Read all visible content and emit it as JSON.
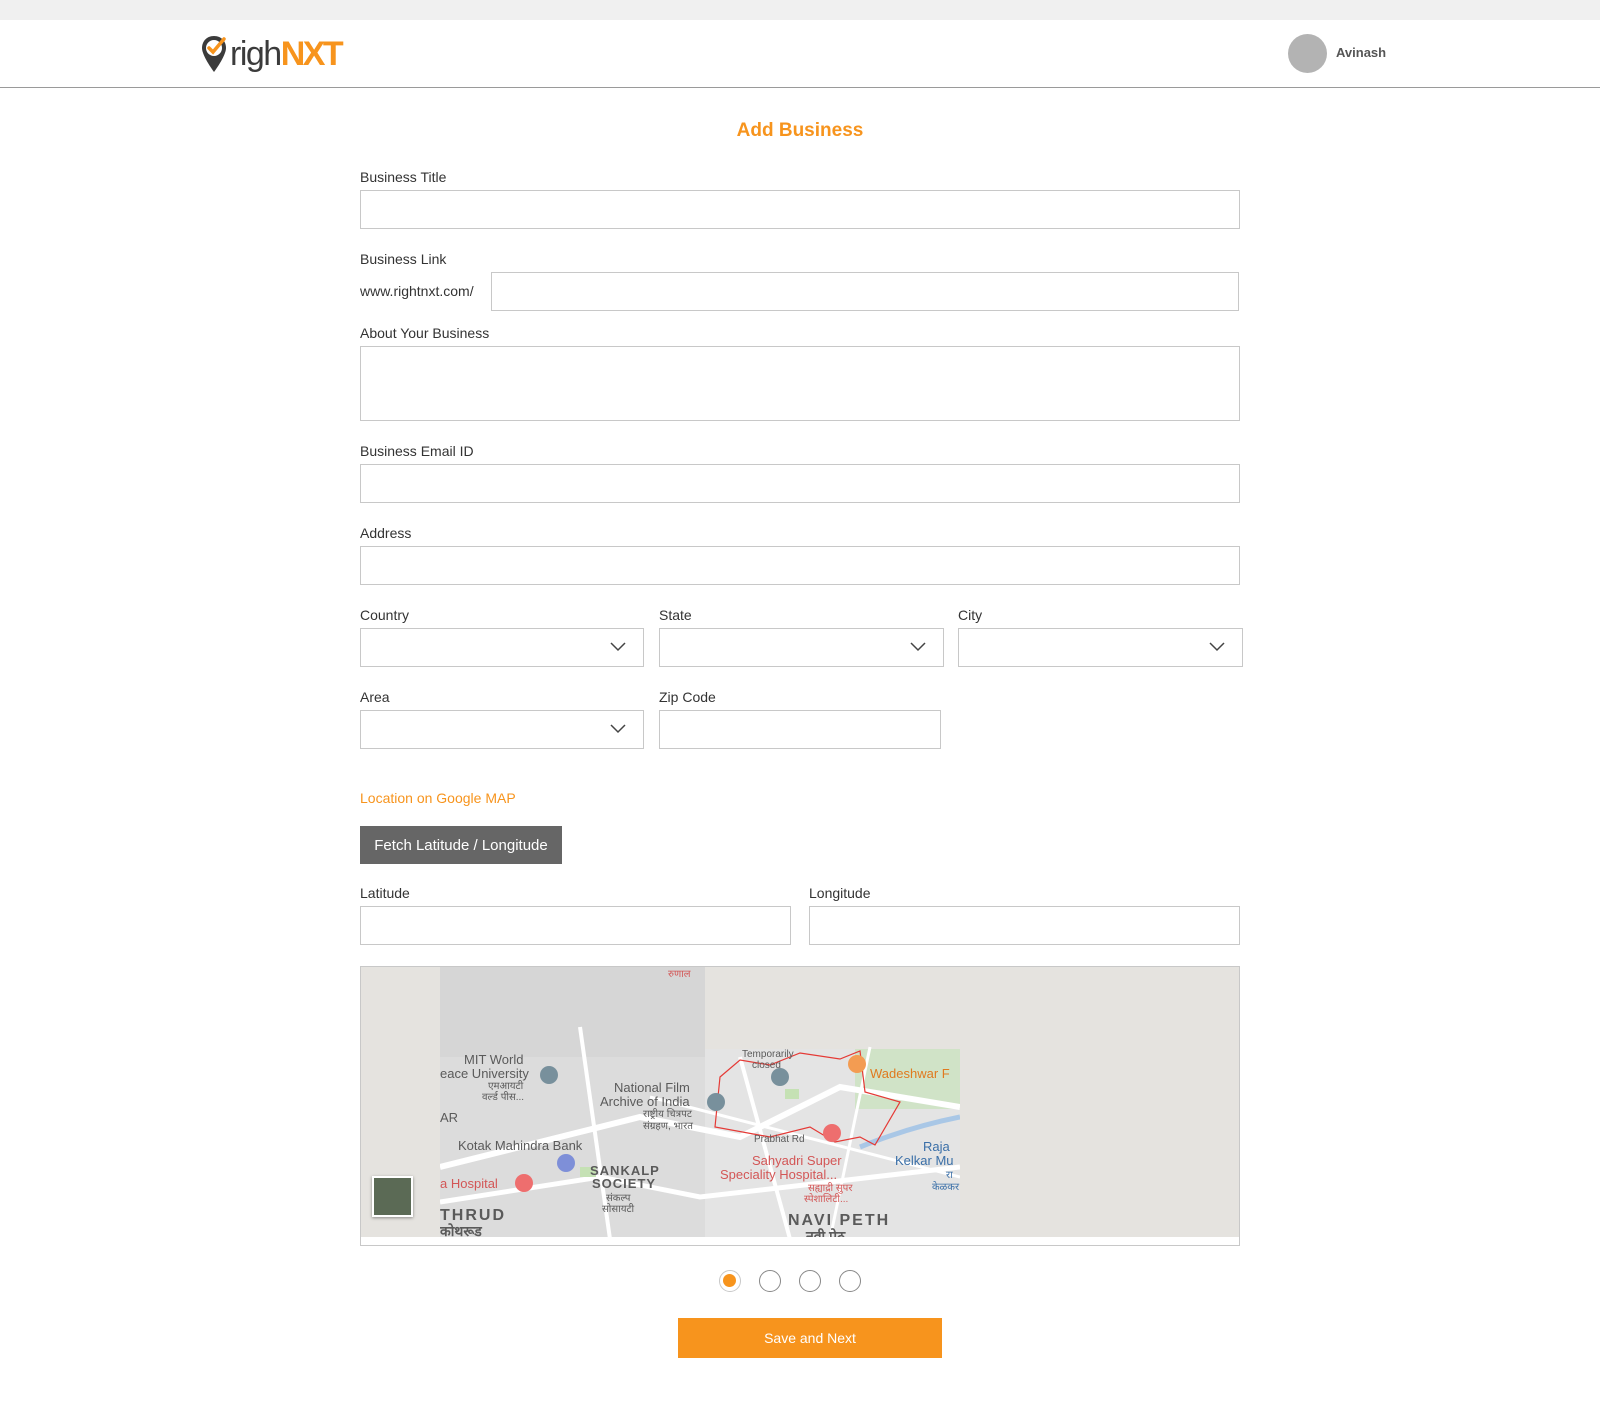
{
  "header": {
    "logo": {
      "text_right": "righ",
      "text_nxt": "NXT",
      "icon": "map-pin-check-icon"
    },
    "user": {
      "name": "Avinash",
      "avatar": "avatar"
    }
  },
  "form": {
    "title": "Add Business",
    "business_title": {
      "label": "Business Title",
      "value": ""
    },
    "business_link": {
      "label": "Business Link",
      "prefix": "www.rightnxt.com/",
      "value": ""
    },
    "about": {
      "label": "About Your Business",
      "value": ""
    },
    "email": {
      "label": "Business Email ID",
      "value": ""
    },
    "address": {
      "label": "Address",
      "value": ""
    },
    "country": {
      "label": "Country",
      "value": ""
    },
    "state": {
      "label": "State",
      "value": ""
    },
    "city": {
      "label": "City",
      "value": ""
    },
    "area": {
      "label": "Area",
      "value": ""
    },
    "zip": {
      "label": "Zip Code",
      "value": ""
    },
    "map_link": "Location on Google MAP",
    "fetch_button": "Fetch Latitude / Longitude",
    "latitude": {
      "label": "Latitude",
      "value": ""
    },
    "longitude": {
      "label": "Longitude",
      "value": ""
    },
    "map": {
      "labels": [
        "MIT World",
        "eace University",
        "एमआयटी",
        "वर्ल्ड पीस...",
        "National Film",
        "Archive of India",
        "राष्ट्रीय चित्रपट",
        "संग्रहण, भारत",
        "Temporarily",
        "closed",
        "Wadeshwar F",
        "Prabhat Rd",
        "Sahyadri Super",
        "Speciality Hospital...",
        "सह्याद्री सुपर",
        "स्पेशालिटी...",
        "Kotak Mahindra Bank",
        "SANKALP",
        "SOCIETY",
        "संकल्प",
        "सोसायटी",
        "a Hospital",
        "THRUD",
        "कोथरूड",
        "NAVI PETH",
        "नवी पेठ",
        "Raja",
        "Kelkar Mu",
        "रा",
        "केळकर",
        "AR",
        "रुणाल"
      ]
    },
    "steps": {
      "total": 4,
      "current": 1
    },
    "save_button": "Save and Next"
  },
  "colors": {
    "accent": "#f7941d",
    "button_dark": "#666666",
    "border": "#c8c8c8"
  }
}
